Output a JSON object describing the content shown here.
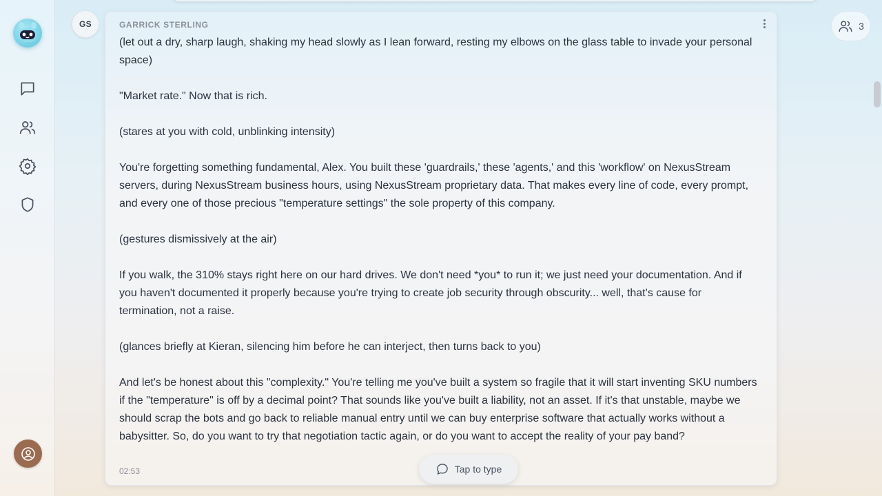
{
  "message": {
    "avatar_initials": "GS",
    "sender": "GARRICK STERLING",
    "paragraphs": [
      "(let out a dry, sharp laugh, shaking my head slowly as I lean forward, resting my elbows on the glass table to invade your personal space)",
      "\"Market rate.\" Now that is rich.",
      "(stares at you with cold, unblinking intensity)",
      "You're forgetting something fundamental, Alex. You built these 'guardrails,' these 'agents,' and this 'workflow' on NexusStream servers, during NexusStream business hours, using NexusStream proprietary data. That makes every line of code, every prompt, and every one of those precious \"temperature settings\" the sole property of this company.",
      "(gestures dismissively at the air)",
      "If you walk, the 310% stays right here on our hard drives. We don't need *you* to run it; we just need your documentation. And if you haven't documented it properly because you're trying to create job security through obscurity... well, that’s cause for termination, not a raise.",
      "(glances briefly at Kieran, silencing him before he can interject, then turns back to you)",
      "And let's be honest about this \"complexity.\" You're telling me you've built a system so fragile that it will start inventing SKU numbers if the \"temperature\" is off by a decimal point? That sounds like you've built a liability, not an asset. If it's that unstable, maybe we should scrap the bots and go back to reliable manual entry until we can buy enterprise software that actually works without a babysitter. So, do you want to try that negotiation tactic again, or do you want to accept the reality of your pay band?"
    ],
    "timestamp": "02:53"
  },
  "composer": {
    "tap_label": "Tap to type"
  },
  "participants": {
    "count": "3"
  },
  "nav": {
    "icons": [
      "chat-icon",
      "users-icon",
      "gear-icon",
      "shield-icon",
      "profile-icon"
    ]
  },
  "colors": {
    "profile_button": "#9b6b50",
    "logo": "#5fc4dd"
  }
}
